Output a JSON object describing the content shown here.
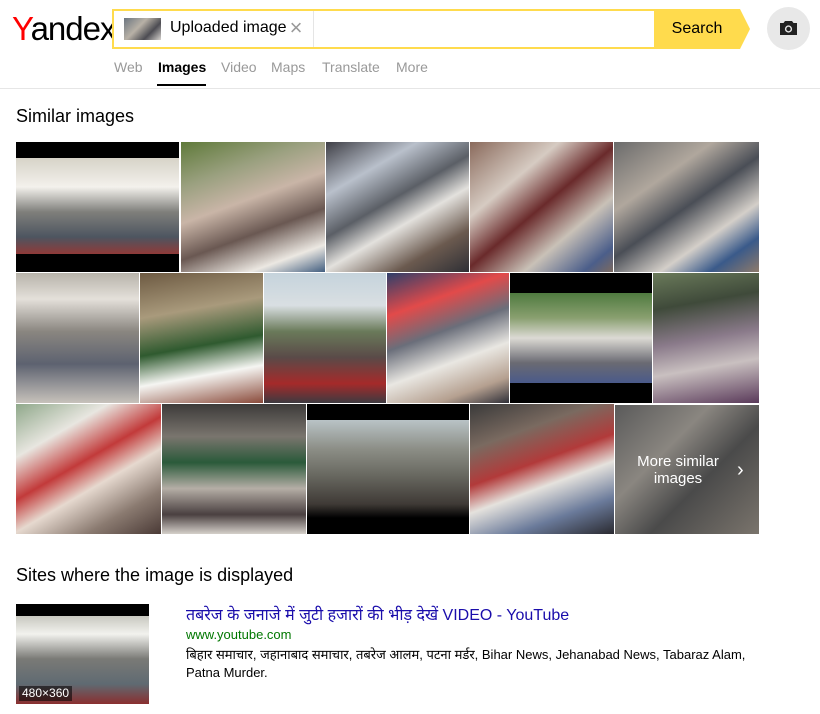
{
  "logo": {
    "first_letter": "Y",
    "rest": "andex"
  },
  "search": {
    "chip_label": "Uploaded image",
    "button_label": "Search"
  },
  "tabs": [
    {
      "label": "Web"
    },
    {
      "label": "Images",
      "active": true
    },
    {
      "label": "Video"
    },
    {
      "label": "Maps"
    },
    {
      "label": "Translate"
    },
    {
      "label": "More"
    }
  ],
  "similar": {
    "title": "Similar images",
    "more_label": "More similar images"
  },
  "sites": {
    "title": "Sites where the image is displayed",
    "result": {
      "title": "तबरेज के जनाजे में जुटी हजारों की भीड़ देखें VIDEO - YouTube",
      "url": "www.youtube.com",
      "description": "बिहार समाचार, जहानाबाद समाचार, तबरेज आलम, पटना मर्डर, Bihar News, Jehanabad News, Tabaraz Alam, Patna Murder.",
      "thumb_dims": "480×360"
    }
  },
  "colors": {
    "accent_yellow": "#ffdb4d",
    "logo_red": "#ff0000",
    "link_blue": "#1a0dab",
    "url_green": "#007700"
  },
  "icons": [
    "close-icon",
    "camera-icon",
    "chevron-right-icon"
  ]
}
